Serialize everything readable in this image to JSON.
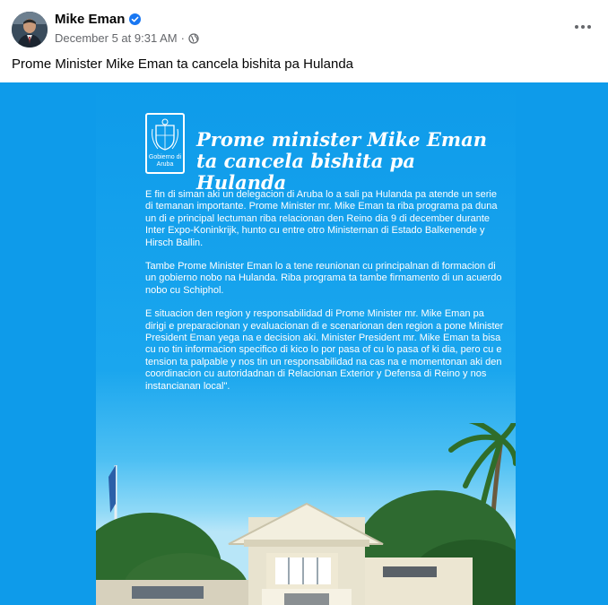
{
  "post": {
    "author": "Mike Eman",
    "timestamp": "December 5 at 9:31 AM",
    "separator": "·",
    "caption": "Prome Minister Mike Eman ta cancela bishita pa Hulanda"
  },
  "poster": {
    "logo_text": "Gobierno di Aruba",
    "headline": "Prome minister Mike Eman ta cancela bishita pa Hulanda",
    "paragraphs": [
      "E fin di siman aki un delegacion di Aruba lo a sali pa Hulanda pa atende un serie di temanan importante. Prome Minister mr. Mike Eman ta riba programa pa duna un di e principal lectuman riba relacionan den Reino  dia 9 di december durante Inter Expo-Koninkrijk, hunto cu entre otro Ministernan di Estado Balkenende y Hirsch Ballin.",
      "Tambe Prome Minister Eman lo a tene reunionan cu principalnan di formacion di un gobierno nobo na Hulanda. Riba programa ta tambe firmamento di un acuerdo nobo cu Schiphol.",
      "E situacion den region y responsabilidad di Prome Minister mr. Mike Eman pa dirigi e preparacionan y evaluacionan di e scenarionan den region a pone Minister President Eman yega na e decision aki. Minister President mr. Mike Eman ta bisa cu no tin informacion specifico di kico lo por pasa of cu lo pasa of ki dia, pero cu e tension ta palpable y nos tin un responsabilidad na cas na e momentonan aki den coordinacion cu autoridadnan di Relacionan Exterior y Defensa di Reino y nos instancianan local\"."
    ]
  },
  "icons": {
    "verified": "verified-badge-icon",
    "privacy": "globe-icon",
    "more": "more-options-icon"
  },
  "colors": {
    "poster_blue": "#0e9bea",
    "verified_blue": "#1877f2",
    "meta_gray": "#65676b"
  }
}
